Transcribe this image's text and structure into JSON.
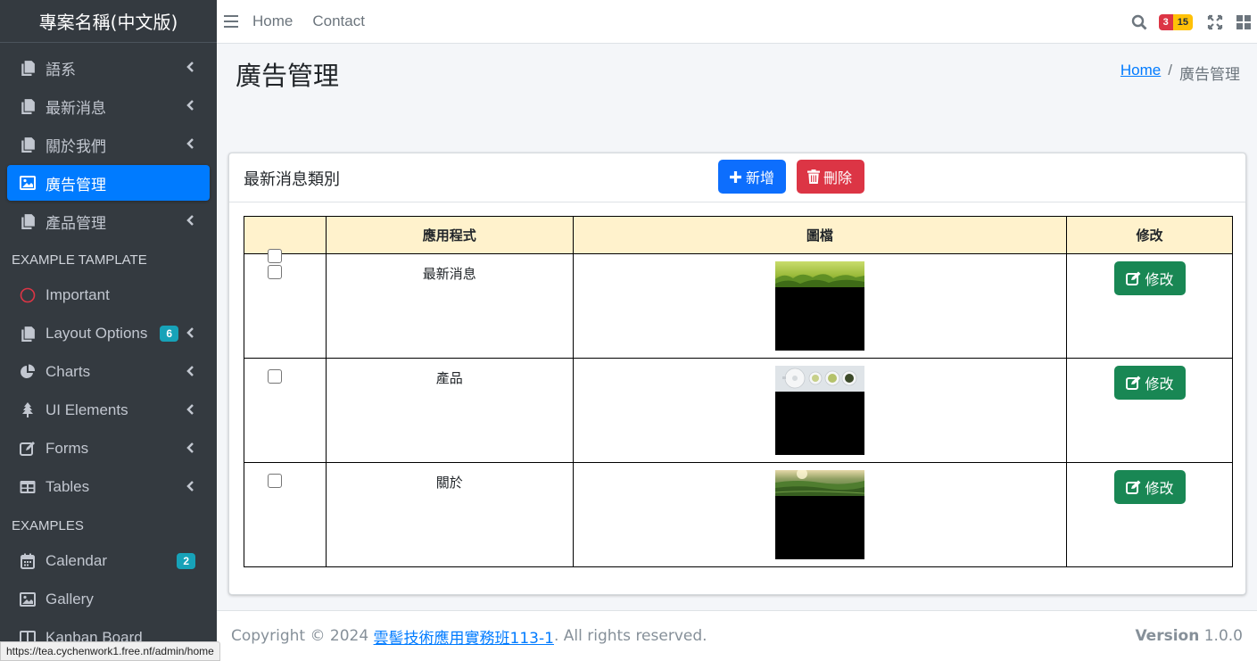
{
  "sidebar": {
    "brand": "專案名稱(中文版)",
    "items": [
      {
        "label": "語系",
        "icon": "copy-icon",
        "chevron": true
      },
      {
        "label": "最新消息",
        "icon": "copy-icon",
        "chevron": true
      },
      {
        "label": "關於我們",
        "icon": "copy-icon",
        "chevron": true
      },
      {
        "label": "廣告管理",
        "icon": "image-icon",
        "active": true
      },
      {
        "label": "產品管理",
        "icon": "copy-icon",
        "chevron": true
      }
    ],
    "header_template": "EXAMPLE TAMPLATE",
    "template_items": [
      {
        "label": "Important",
        "icon": "circle-icon"
      },
      {
        "label": "Layout Options",
        "icon": "copy-icon",
        "badge": "6",
        "chevron": true
      },
      {
        "label": "Charts",
        "icon": "pie-chart-icon",
        "chevron": true
      },
      {
        "label": "UI Elements",
        "icon": "tree-icon",
        "chevron": true
      },
      {
        "label": "Forms",
        "icon": "edit-icon",
        "chevron": true
      },
      {
        "label": "Tables",
        "icon": "table-icon",
        "chevron": true
      }
    ],
    "header_examples": "EXAMPLES",
    "example_items": [
      {
        "label": "Calendar",
        "icon": "calendar-icon",
        "badge": "2"
      },
      {
        "label": "Gallery",
        "icon": "image-icon"
      },
      {
        "label": "Kanban Board",
        "icon": "columns-icon"
      }
    ]
  },
  "topbar": {
    "links": [
      "Home",
      "Contact"
    ],
    "badge_messages": "3",
    "badge_notifications": "15"
  },
  "page": {
    "title": "廣告管理",
    "breadcrumb_home": "Home",
    "breadcrumb_sep": "/",
    "breadcrumb_current": "廣告管理"
  },
  "card": {
    "title": "最新消息類別",
    "add_label": "新增",
    "delete_label": "刪除",
    "columns": [
      "",
      "應用程式",
      "圖檔",
      "修改"
    ],
    "rows": [
      {
        "app": "最新消息",
        "edit_label": "修改",
        "image": "green-tea-leaves"
      },
      {
        "app": "產品",
        "edit_label": "修改",
        "image": "tea-cups-top-view"
      },
      {
        "app": "關於",
        "edit_label": "修改",
        "image": "tea-plantation-sunrise"
      }
    ]
  },
  "footer": {
    "copyright": "Copyright © 2024 ",
    "link": "雲髻技術應用實務班113-1",
    "rights": ". All rights reserved.",
    "version_label": "Version",
    "version": " 1.0.0"
  },
  "statusbar": {
    "url": "https://tea.cychenwork1.free.nf/admin/home"
  },
  "colors": {
    "sidebar_bg": "#343a40",
    "active": "#007bff",
    "add_button": "#0d6efd",
    "delete_button": "#dc3545",
    "edit_button": "#198754",
    "table_header": "#fff2cc"
  }
}
